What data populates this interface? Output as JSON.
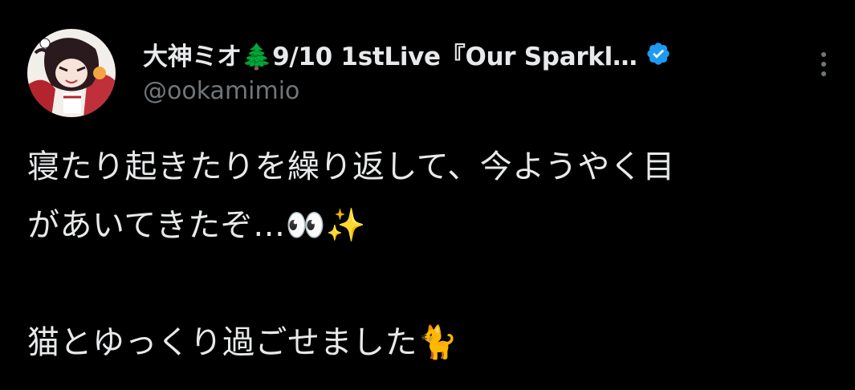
{
  "tweet": {
    "display_name": "大神ミオ🌲9/10 1stLive『Our Sparkl…",
    "handle": "@ookamimio",
    "body_lines": [
      "寝たり起きたりを繰り返して、今ようやく目",
      "があいてきたぞ…👀✨",
      "",
      "猫とゆっくり過ごせました🐈"
    ]
  },
  "icons": {
    "verified": "verified-badge-icon",
    "more": "more-options-icon",
    "avatar": "profile-avatar"
  },
  "colors": {
    "background": "#000000",
    "text_primary": "#e7e9ea",
    "text_secondary": "#71767b",
    "verified_blue": "#1d9bf0"
  }
}
